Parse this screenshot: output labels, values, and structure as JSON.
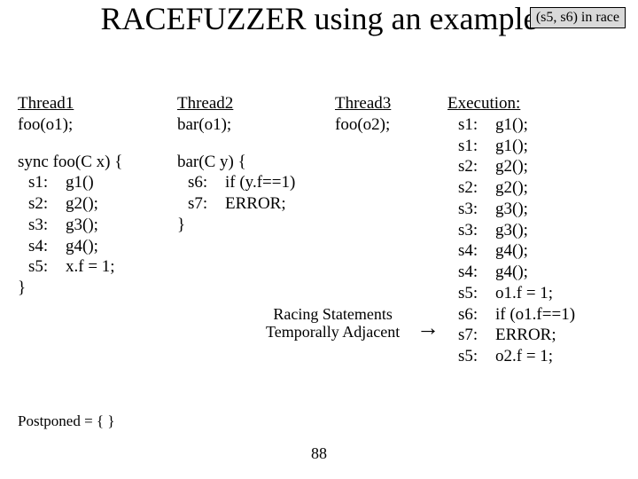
{
  "title": "RACEFUZZER using an example",
  "race_tag": "(s5, s6) in race",
  "page_number": "88",
  "threads": {
    "t1": {
      "header": "Thread1",
      "call": "foo(o1);"
    },
    "t2": {
      "header": "Thread2",
      "call": "bar(o1);"
    },
    "t3": {
      "header": "Thread3",
      "call": "foo(o2);"
    }
  },
  "foo_code": {
    "sig": "sync foo(C x) {",
    "lines": [
      {
        "lab": "s1:",
        "code": "g1()"
      },
      {
        "lab": "s2:",
        "code": "g2();"
      },
      {
        "lab": "s3:",
        "code": "g3();"
      },
      {
        "lab": "s4:",
        "code": "g4();"
      },
      {
        "lab": "s5:",
        "code": "x.f = 1;"
      }
    ],
    "close": "}"
  },
  "bar_code": {
    "sig": "bar(C y) {",
    "lines": [
      {
        "lab": "s6:",
        "code": "if (y.f==1)"
      },
      {
        "lab": "s7:",
        "code": "   ERROR;"
      }
    ],
    "close": "}"
  },
  "callout": {
    "l1": "Racing Statements",
    "l2": "Temporally Adjacent"
  },
  "execution": {
    "header": "Execution:",
    "steps": [
      {
        "lab": "s1:",
        "code": "g1();"
      },
      {
        "lab": "s1:",
        "code": "g1();"
      },
      {
        "lab": "s2:",
        "code": "g2();"
      },
      {
        "lab": "s2:",
        "code": "g2();"
      },
      {
        "lab": "s3:",
        "code": "g3();"
      },
      {
        "lab": "s3:",
        "code": "g3();"
      },
      {
        "lab": "s4:",
        "code": "g4();"
      },
      {
        "lab": "s4:",
        "code": "g4();"
      },
      {
        "lab": "s5:",
        "code": "o1.f = 1;"
      },
      {
        "lab": "s6:",
        "code": "if (o1.f==1)"
      },
      {
        "lab": "s7:",
        "code": "   ERROR;"
      },
      {
        "lab": "s5:",
        "code": "o2.f = 1;"
      }
    ]
  },
  "postponed": "Postponed = {  }"
}
